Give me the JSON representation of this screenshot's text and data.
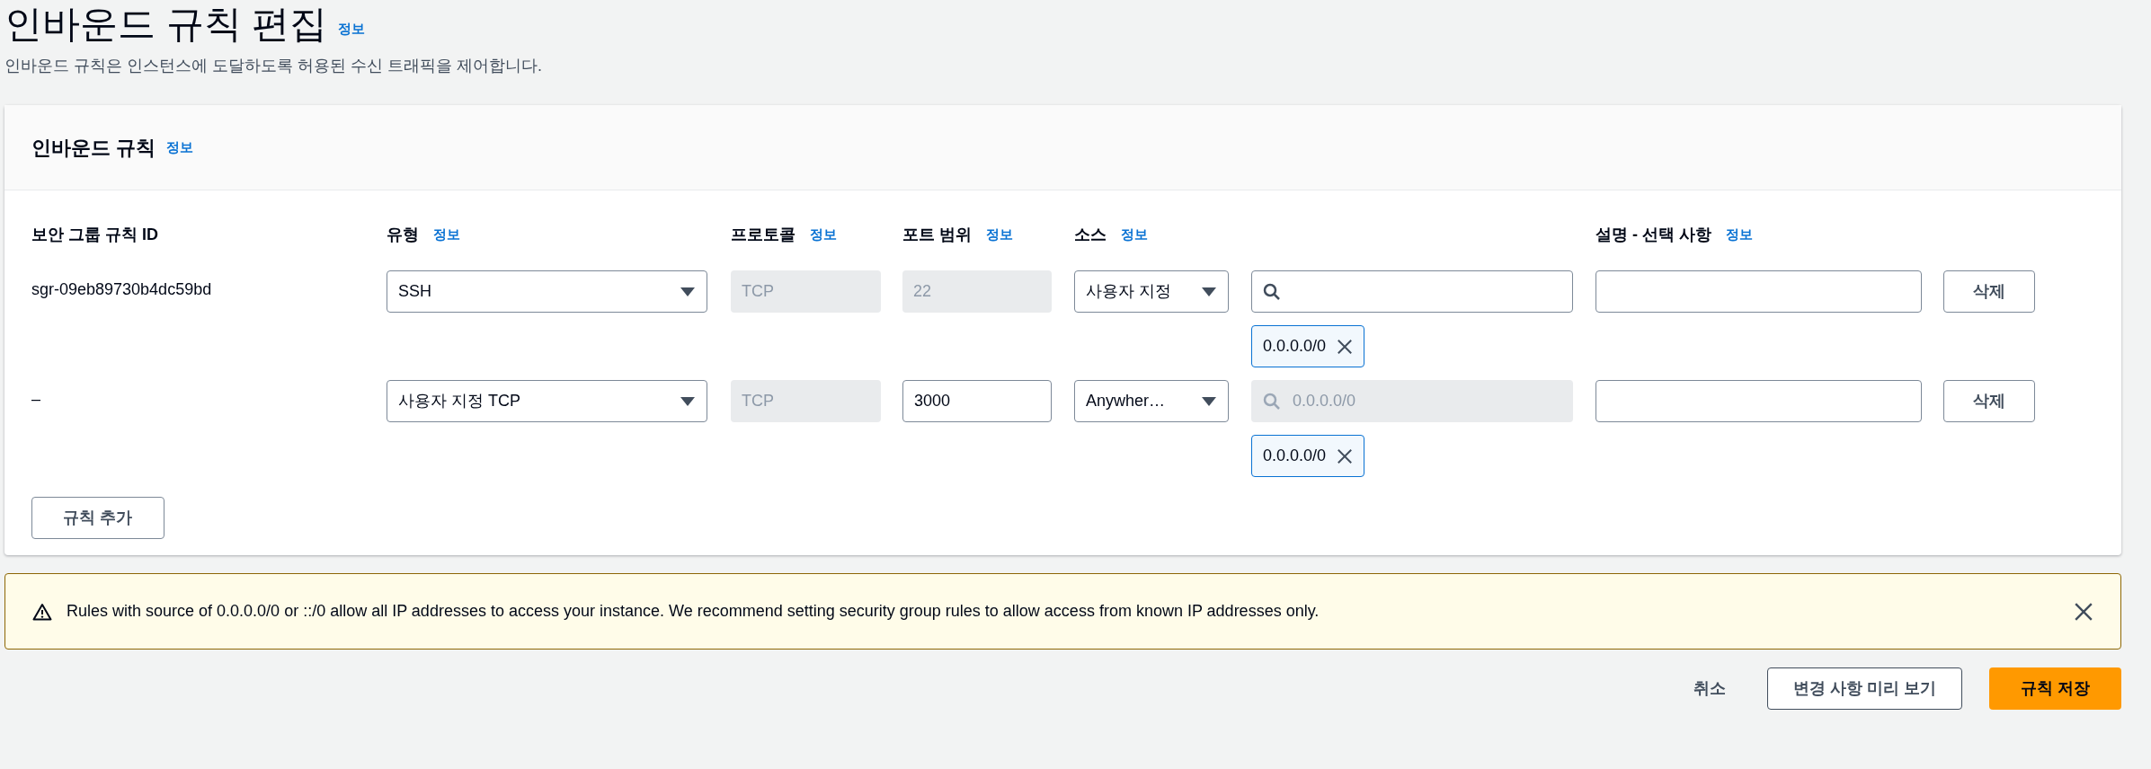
{
  "page": {
    "title": "인바운드 규칙 편집",
    "info_link": "정보",
    "description": "인바운드 규칙은 인스턴스에 도달하도록 허용된 수신 트래픽을 제어합니다."
  },
  "card": {
    "title": "인바운드 규칙",
    "info_link": "정보",
    "columns": [
      {
        "label": "보안 그룹 규칙 ID"
      },
      {
        "label": "유형",
        "info": "정보"
      },
      {
        "label": "프로토콜",
        "info": "정보"
      },
      {
        "label": "포트 범위",
        "info": "정보"
      },
      {
        "label": "소스",
        "info": "정보"
      },
      {
        "label": "설명 - 선택 사항",
        "info": "정보"
      }
    ],
    "rows": [
      {
        "rule_id": "sgr-09eb89730b4dc59bd",
        "type": "SSH",
        "protocol": "TCP",
        "port": "22",
        "port_editable": false,
        "source": "사용자 지정",
        "search": {
          "disabled": false
        },
        "chips": [
          "0.0.0.0/0"
        ],
        "delete": "삭제"
      },
      {
        "rule_id": "–",
        "type": "사용자 지정 TCP",
        "protocol": "TCP",
        "port": "3000",
        "port_editable": true,
        "source": "Anywher…",
        "search": {
          "disabled": true,
          "placeholder": "0.0.0.0/0"
        },
        "chips": [
          "0.0.0.0/0"
        ],
        "delete": "삭제"
      }
    ],
    "add_button": "규칙 추가"
  },
  "warning": {
    "text": "Rules with source of 0.0.0.0/0 or ::/0 allow all IP addresses to access your instance. We recommend setting security group rules to allow access from known IP addresses only."
  },
  "footer": {
    "cancel": "취소",
    "preview": "변경 사항 미리 보기",
    "save": "규칙 저장"
  }
}
